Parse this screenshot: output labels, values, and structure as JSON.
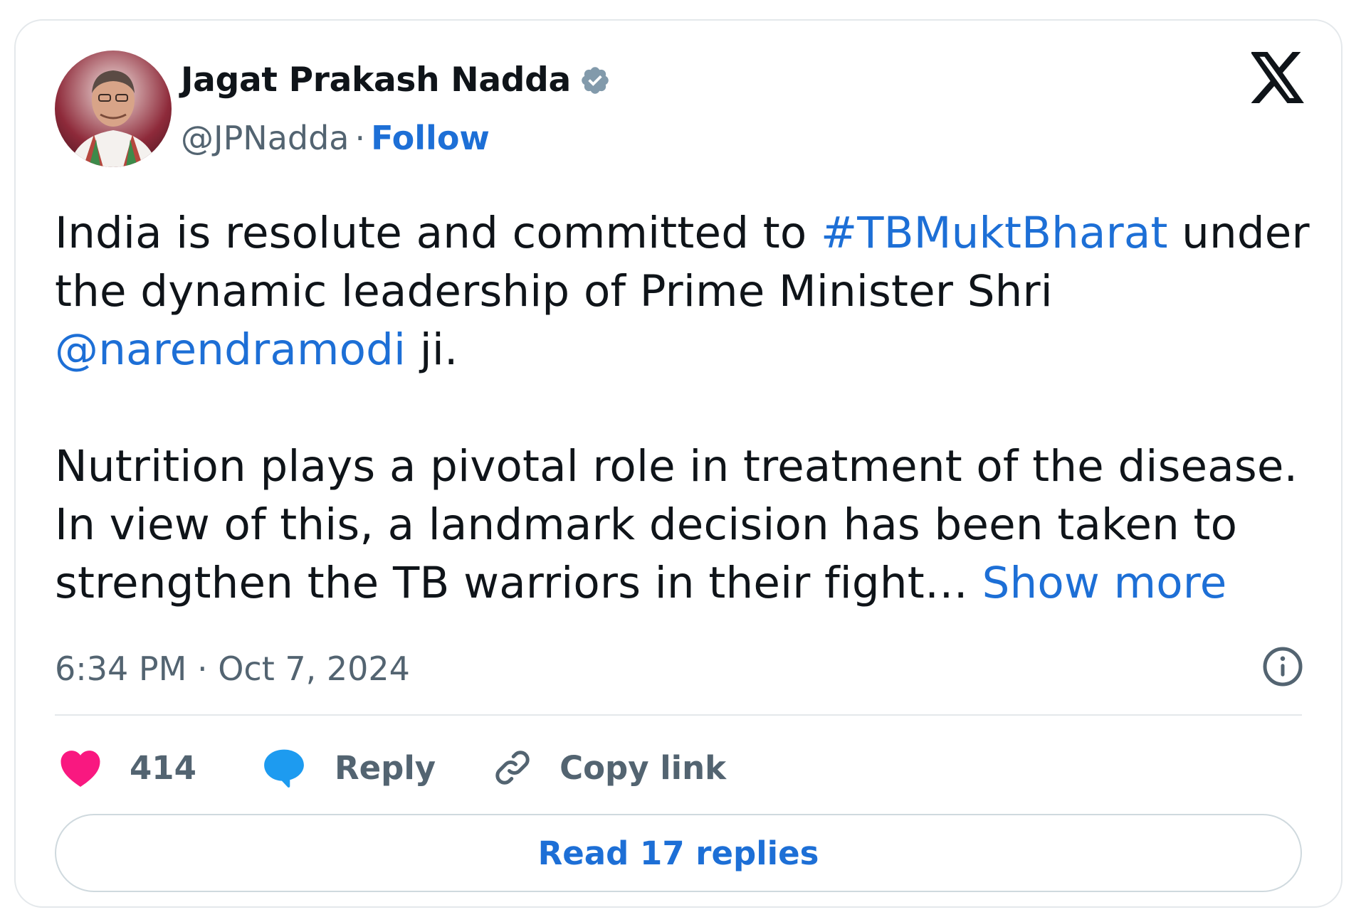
{
  "author": {
    "name": "Jagat Prakash Nadda",
    "handle": "@JPNadda",
    "separator": "·",
    "follow_label": "Follow",
    "verified": true
  },
  "tweet": {
    "line1_pre": "India is resolute and committed to ",
    "hashtag": "#TBMuktBharat",
    "line1_post": " under",
    "line2": "the dynamic leadership of Prime Minister Shri",
    "mention": "@narendramodi",
    "line3_post": " ji.",
    "para2": "Nutrition plays a pivotal role in treatment of the disease.\nIn view of this, a landmark decision has been taken to\nstrengthen the TB warriors in their fight… ",
    "show_more": "Show more"
  },
  "timestamp": "6:34 PM · Oct 7, 2024",
  "actions": {
    "like_count": "414",
    "reply_label": "Reply",
    "copy_label": "Copy link"
  },
  "read_replies_label": "Read 17 replies",
  "colors": {
    "accent": "#1d6fd6",
    "like": "#f91880",
    "reply_icon": "#1d9bf0",
    "muted": "#536471",
    "text": "#0f1419"
  },
  "icons": {
    "verified": "verified-badge-icon",
    "platform": "x-logo-icon",
    "info": "info-icon",
    "like": "heart-icon",
    "reply": "speech-bubble-icon",
    "copy": "link-icon"
  }
}
